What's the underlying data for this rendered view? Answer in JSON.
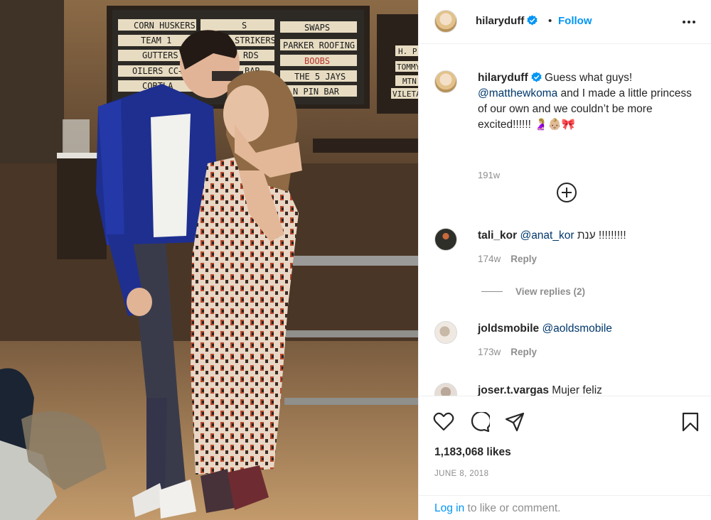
{
  "post": {
    "username": "hilaryduff",
    "follow_label": "Follow",
    "separator": "•"
  },
  "sign": {
    "left": [
      "CORN HUSKERS",
      "TEAM 1",
      "GUTTERS",
      "OILERS CC+N",
      "CORTLA"
    ],
    "middle": [
      "S",
      "STRIKERS",
      "RDS",
      "BAR",
      ""
    ],
    "right": [
      "SWAPS",
      "PARKER ROOFING",
      "BOOBS",
      "THE 5 JAYS",
      "N PIN BAR"
    ],
    "far": [
      "H. P",
      "TOMMY",
      "MTN",
      "VILETA"
    ]
  },
  "caption": {
    "username": "hilaryduff",
    "text_1": "Guess what guys! ",
    "mention": "@matthewkoma",
    "text_2": " and I made a little princess of our own and we couldn’t be more excited!!!!!! 🤰🏼👶🏼🎀",
    "time": "191w"
  },
  "comments": [
    {
      "username": "tali_kor",
      "mention": "@anat_kor",
      "text": " ענת !!!!!!!!!",
      "time": "174w",
      "reply_label": "Reply"
    },
    {
      "username": "joldsmobile",
      "mention": "@aoldsmobile",
      "text": "",
      "time": "173w",
      "reply_label": "Reply"
    },
    {
      "username": "joser.t.vargas",
      "mention": "",
      "text": " Mujer feliz",
      "time": "",
      "reply_label": ""
    }
  ],
  "view_replies_label": "View replies (2)",
  "likes_text": "1,183,068 likes",
  "date_text": "June 8, 2018",
  "footer": {
    "login_label": "Log in",
    "suffix": " to like or comment."
  },
  "colors": {
    "link": "#0095f6",
    "mention": "#00376b",
    "muted": "#8e8e8e",
    "text": "#262626",
    "border": "#efefef"
  },
  "icons": [
    "verified-icon",
    "more-options-icon",
    "add-circle-icon",
    "heart-icon",
    "comment-icon",
    "share-icon",
    "bookmark-icon"
  ]
}
